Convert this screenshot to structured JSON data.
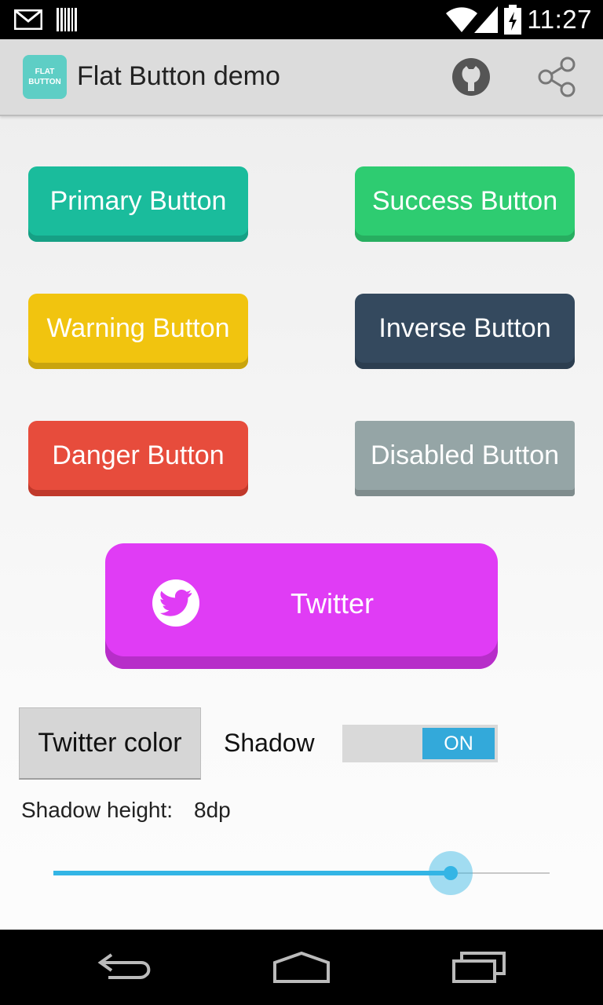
{
  "status_bar": {
    "time": "11:27",
    "icons": [
      "gmail-icon",
      "barcode-icon",
      "wifi-icon",
      "signal-icon",
      "battery-charging-icon"
    ]
  },
  "action_bar": {
    "app_icon_line1": "FLAT",
    "app_icon_line2": "BUTTON",
    "title": "Flat Button demo",
    "actions": [
      "github-icon",
      "share-icon"
    ]
  },
  "buttons": [
    {
      "label": "Primary Button",
      "color": "#1abc9c",
      "shadow": "#16a085"
    },
    {
      "label": "Success Button",
      "color": "#2ecc71",
      "shadow": "#27ae60"
    },
    {
      "label": "Warning Button",
      "color": "#f1c40f",
      "shadow": "#c9a40d"
    },
    {
      "label": "Inverse Button",
      "color": "#34495e",
      "shadow": "#2c3e50"
    },
    {
      "label": "Danger Button",
      "color": "#e74c3c",
      "shadow": "#c0392b"
    },
    {
      "label": "Disabled Button",
      "color": "#95a5a6",
      "shadow": "#7f8c8d"
    }
  ],
  "twitter_button": {
    "label": "Twitter",
    "color": "#e03cf5",
    "shadow": "#b72ec9",
    "icon": "twitter-bird-icon"
  },
  "controls": {
    "twitter_color_label": "Twitter color",
    "shadow_label": "Shadow",
    "shadow_toggle_state": "ON",
    "shadow_height_label": "Shadow height:",
    "shadow_height_value": "8dp",
    "slider_fraction": 0.8,
    "accent": "#33b5e5"
  },
  "nav_bar": {
    "buttons": [
      "back-icon",
      "home-icon",
      "recents-icon"
    ]
  }
}
